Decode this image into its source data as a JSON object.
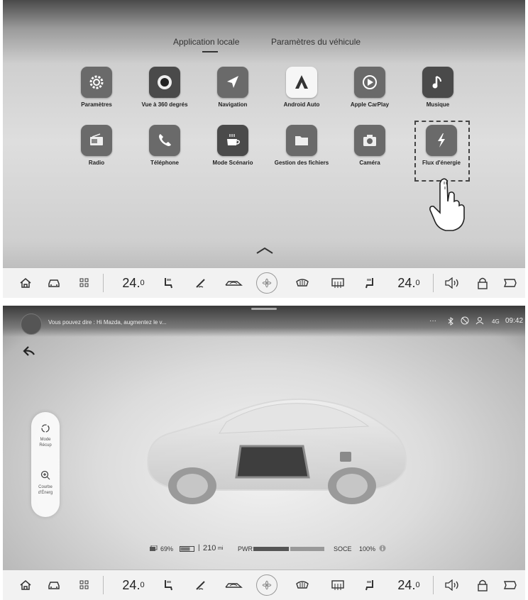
{
  "screen1": {
    "tabs": [
      {
        "label": "Application locale",
        "active": true
      },
      {
        "label": "Paramètres du véhicule",
        "active": false
      }
    ],
    "apps": [
      {
        "label": "Paramètres",
        "icon": "gear-icon"
      },
      {
        "label": "Vue à 360 degrés",
        "icon": "camera-360-icon"
      },
      {
        "label": "Navigation",
        "icon": "navigation-arrow-icon"
      },
      {
        "label": "Android Auto",
        "icon": "android-auto-icon"
      },
      {
        "label": "Apple CarPlay",
        "icon": "carplay-icon"
      },
      {
        "label": "Musique",
        "icon": "music-note-icon"
      },
      {
        "label": "Radio",
        "icon": "radio-icon"
      },
      {
        "label": "Téléphone",
        "icon": "phone-icon"
      },
      {
        "label": "Mode Scénario",
        "icon": "cup-icon"
      },
      {
        "label": "Gestion des fichiers",
        "icon": "folder-icon"
      },
      {
        "label": "Caméra",
        "icon": "camera-icon"
      },
      {
        "label": "Flux d'énergie",
        "icon": "energy-flow-icon"
      }
    ]
  },
  "climate": {
    "temp_left": "24.",
    "temp_left_dec": "0",
    "temp_right": "24.",
    "temp_right_dec": "0"
  },
  "screen2": {
    "voice_hint": "Vous pouvez dire : Hi Mazda, augmentez le v...",
    "status_dots": "···",
    "signal": "4G",
    "time": "09:42",
    "side": [
      {
        "label1": "Mode",
        "label2": "Récup"
      },
      {
        "label1": "Courbe",
        "label2": "d'Énerg"
      }
    ],
    "battery_pct": "69%",
    "range_value": "210",
    "range_unit": "mi",
    "pwr_label": "PWR",
    "soce_label": "SOCE",
    "soce_value": "100%"
  }
}
